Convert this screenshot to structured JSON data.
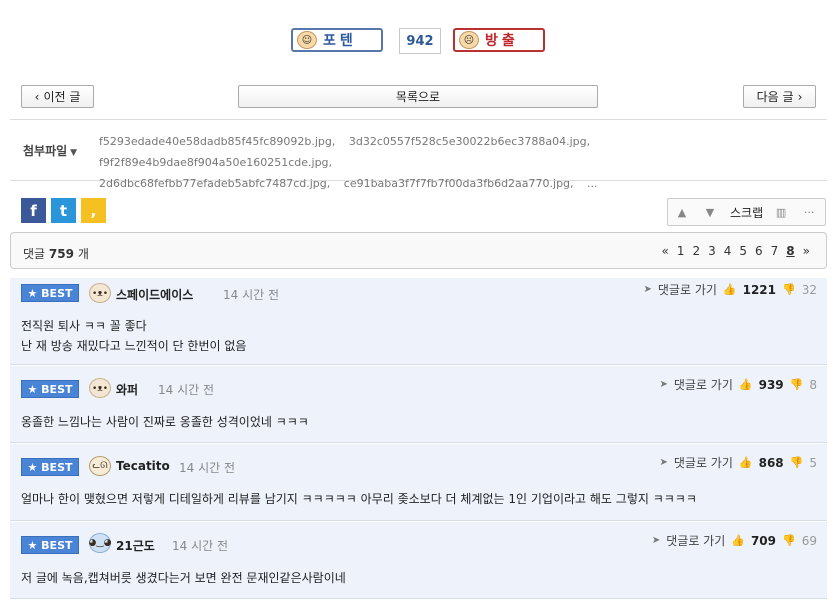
{
  "vote": {
    "up_label": "포텐",
    "count": "942",
    "down_label": "방출"
  },
  "nav": {
    "prev": "이전 글",
    "list": "목록으로",
    "next": "다음 글"
  },
  "attachments": {
    "label": "첨부파일",
    "files": [
      "f5293edade40e58dadb85f45fc89092b.jpg,",
      "3d32c0557f528c5e30022b6ec3788a04.jpg,",
      "f9f2f89e4b9dae8f904a50e160251cde.jpg,",
      "2d6dbc68fefbb77efadeb5abfc7487cd.jpg,",
      "ce91baba3f7f7fb7f00da3fb6d2aa770.jpg,",
      "..."
    ]
  },
  "social": {
    "facebook": "f",
    "twitter": "t",
    "kakaostory": ","
  },
  "tools": {
    "scrap": "스크랩"
  },
  "comments_header": {
    "prefix": "댓글",
    "count": "759",
    "suffix": "개",
    "pages": [
      "«",
      "1",
      "2",
      "3",
      "4",
      "5",
      "6",
      "7",
      "8",
      "»"
    ],
    "current_page": "8"
  },
  "comments": [
    {
      "badge": "★ BEST",
      "nick": "스페이드에이스",
      "ago": "14 시간 전",
      "goto": "댓글로 가기",
      "up": "1221",
      "down": "32",
      "lines": [
        "전직원 퇴사 ㅋㅋ 꼴 좋다",
        "난 재 방송 재밌다고 느낀적이 단 한번이 없음"
      ]
    },
    {
      "badge": "★ BEST",
      "nick": "와퍼",
      "ago": "14 시간 전",
      "goto": "댓글로 가기",
      "up": "939",
      "down": "8",
      "lines": [
        "옹졸한 느낌나는 사람이 진짜로 옹졸한 성격이었네 ㅋㅋㅋ"
      ]
    },
    {
      "badge": "★ BEST",
      "nick": "Tecatito",
      "ago": "14 시간 전",
      "goto": "댓글로 가기",
      "up": "868",
      "down": "5",
      "lines": [
        "얼마나 한이 맺혔으면 저렇게 디테일하게 리뷰를 남기지 ㅋㅋㅋㅋㅋ 아무리 좆소보다 더 체계없는 1인 기업이라고 해도 그렇지 ㅋㅋㅋㅋ"
      ]
    },
    {
      "badge": "★ BEST",
      "nick": "21근도",
      "ago": "14 시간 전",
      "goto": "댓글로 가기",
      "up": "709",
      "down": "69",
      "lines": [
        "저 글에 녹음,캡쳐버릇 생겼다는거 보면 완전 문재인같은사람이네"
      ]
    }
  ]
}
